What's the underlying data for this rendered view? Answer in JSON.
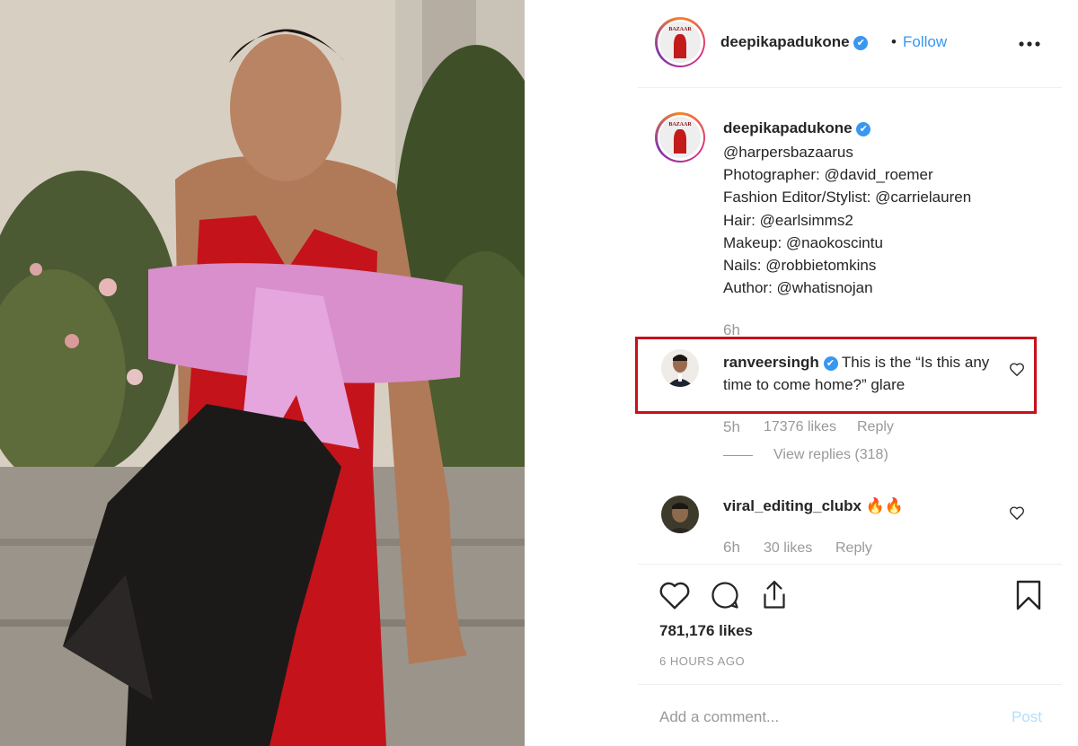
{
  "post": {
    "username": "deepikapadukone",
    "verified_glyph": "✔",
    "dot": "•",
    "follow_label": "Follow",
    "more_label": "•••",
    "caption_lines": [
      "@harpersbazaarus",
      "Photographer: @david_roemer",
      "Fashion Editor/Stylist: @carrielauren",
      "Hair: @earlsimms2",
      "Makeup: @naokoscintu",
      "Nails: @robbietomkins",
      "Author: @whatisnojan"
    ],
    "caption_time": "6h"
  },
  "comments": [
    {
      "username": "ranveersingh",
      "text": "This is the “Is this any time to come home?” glare",
      "time": "5h",
      "likes": "17376 likes",
      "reply": "Reply",
      "view_replies": "View replies (318)",
      "highlighted": true
    },
    {
      "username": "viral_editing_clubx",
      "text": "🔥🔥",
      "time": "6h",
      "likes": "30 likes",
      "reply": "Reply"
    }
  ],
  "footer": {
    "likes": "781,176 likes",
    "time_ago": "6 HOURS AGO",
    "add_comment_placeholder": "Add a comment...",
    "post_label": "Post"
  },
  "icons": {
    "like": "heart-icon",
    "comment": "comment-icon",
    "share": "share-icon",
    "save": "bookmark-icon",
    "more": "more-options-icon"
  },
  "colors": {
    "link": "#3897f0",
    "highlight_border": "#c8101c",
    "muted": "#999999",
    "post_disabled": "#b2dffc"
  }
}
